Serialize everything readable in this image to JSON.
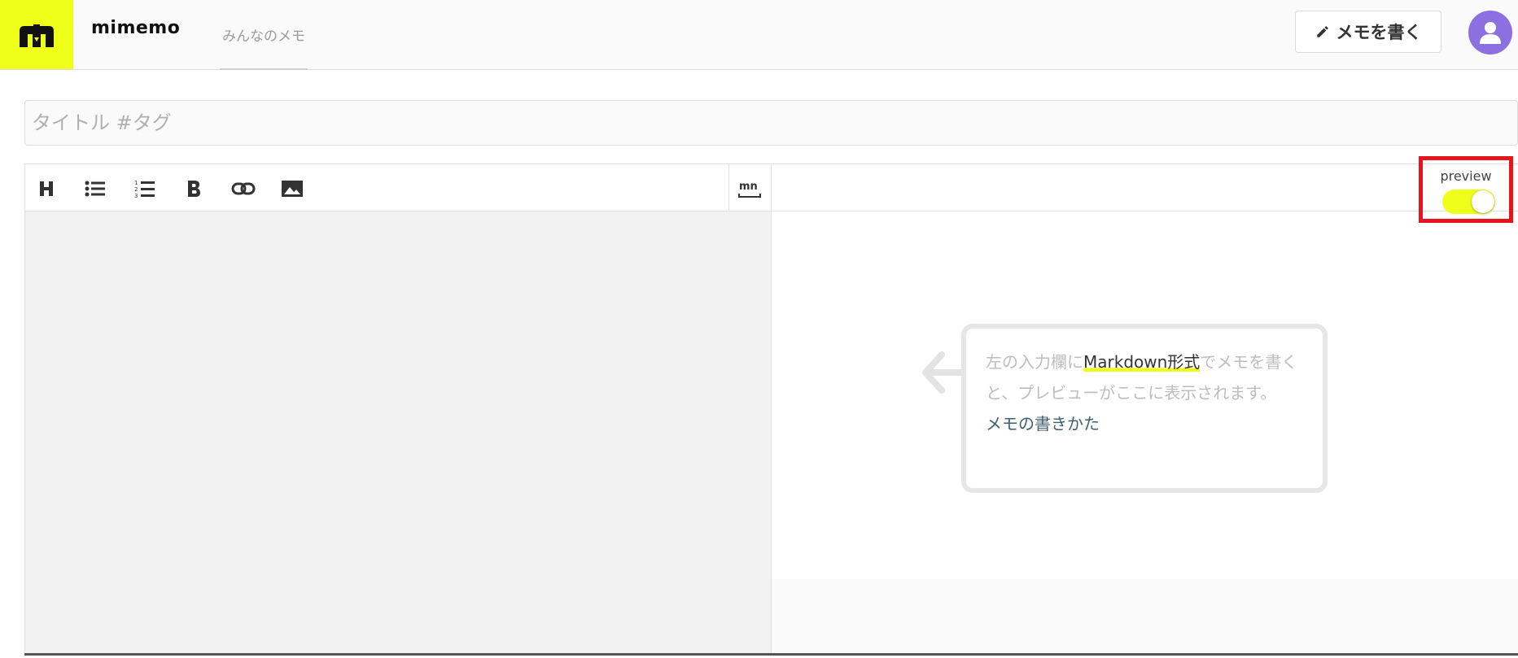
{
  "header": {
    "brand": "mimemo",
    "nav_tab": "みんなのメモ",
    "write_button": "メモを書く"
  },
  "editor": {
    "title_placeholder": "タイトル #タグ",
    "title_value": "",
    "body_value": "",
    "toolbar": [
      "heading-icon",
      "bulleted-list-icon",
      "numbered-list-icon",
      "bold-icon",
      "link-icon",
      "image-icon",
      "markdown-notation-icon"
    ]
  },
  "preview": {
    "toggle_label": "preview",
    "toggle_on": true,
    "hint_before": "左の入力欄に",
    "hint_highlight": "Markdown形式",
    "hint_after": "でメモを書くと、プレビューがここに表示されます。",
    "hint_link": "メモの書きかた"
  },
  "colors": {
    "accent": "#eeff1a",
    "avatar": "#8c6fe0",
    "highlight_box": "#e8141b",
    "link": "#41606e"
  }
}
